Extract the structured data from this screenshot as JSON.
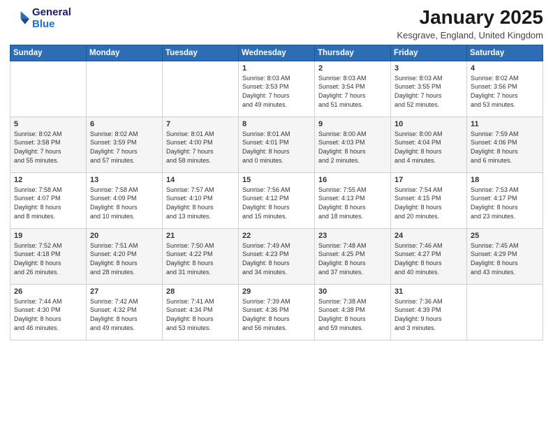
{
  "logo": {
    "line1": "General",
    "line2": "Blue"
  },
  "title": "January 2025",
  "location": "Kesgrave, England, United Kingdom",
  "days_header": [
    "Sunday",
    "Monday",
    "Tuesday",
    "Wednesday",
    "Thursday",
    "Friday",
    "Saturday"
  ],
  "weeks": [
    [
      {
        "num": "",
        "info": ""
      },
      {
        "num": "",
        "info": ""
      },
      {
        "num": "",
        "info": ""
      },
      {
        "num": "1",
        "info": "Sunrise: 8:03 AM\nSunset: 3:53 PM\nDaylight: 7 hours\nand 49 minutes."
      },
      {
        "num": "2",
        "info": "Sunrise: 8:03 AM\nSunset: 3:54 PM\nDaylight: 7 hours\nand 51 minutes."
      },
      {
        "num": "3",
        "info": "Sunrise: 8:03 AM\nSunset: 3:55 PM\nDaylight: 7 hours\nand 52 minutes."
      },
      {
        "num": "4",
        "info": "Sunrise: 8:02 AM\nSunset: 3:56 PM\nDaylight: 7 hours\nand 53 minutes."
      }
    ],
    [
      {
        "num": "5",
        "info": "Sunrise: 8:02 AM\nSunset: 3:58 PM\nDaylight: 7 hours\nand 55 minutes."
      },
      {
        "num": "6",
        "info": "Sunrise: 8:02 AM\nSunset: 3:59 PM\nDaylight: 7 hours\nand 57 minutes."
      },
      {
        "num": "7",
        "info": "Sunrise: 8:01 AM\nSunset: 4:00 PM\nDaylight: 7 hours\nand 58 minutes."
      },
      {
        "num": "8",
        "info": "Sunrise: 8:01 AM\nSunset: 4:01 PM\nDaylight: 8 hours\nand 0 minutes."
      },
      {
        "num": "9",
        "info": "Sunrise: 8:00 AM\nSunset: 4:03 PM\nDaylight: 8 hours\nand 2 minutes."
      },
      {
        "num": "10",
        "info": "Sunrise: 8:00 AM\nSunset: 4:04 PM\nDaylight: 8 hours\nand 4 minutes."
      },
      {
        "num": "11",
        "info": "Sunrise: 7:59 AM\nSunset: 4:06 PM\nDaylight: 8 hours\nand 6 minutes."
      }
    ],
    [
      {
        "num": "12",
        "info": "Sunrise: 7:58 AM\nSunset: 4:07 PM\nDaylight: 8 hours\nand 8 minutes."
      },
      {
        "num": "13",
        "info": "Sunrise: 7:58 AM\nSunset: 4:09 PM\nDaylight: 8 hours\nand 10 minutes."
      },
      {
        "num": "14",
        "info": "Sunrise: 7:57 AM\nSunset: 4:10 PM\nDaylight: 8 hours\nand 13 minutes."
      },
      {
        "num": "15",
        "info": "Sunrise: 7:56 AM\nSunset: 4:12 PM\nDaylight: 8 hours\nand 15 minutes."
      },
      {
        "num": "16",
        "info": "Sunrise: 7:55 AM\nSunset: 4:13 PM\nDaylight: 8 hours\nand 18 minutes."
      },
      {
        "num": "17",
        "info": "Sunrise: 7:54 AM\nSunset: 4:15 PM\nDaylight: 8 hours\nand 20 minutes."
      },
      {
        "num": "18",
        "info": "Sunrise: 7:53 AM\nSunset: 4:17 PM\nDaylight: 8 hours\nand 23 minutes."
      }
    ],
    [
      {
        "num": "19",
        "info": "Sunrise: 7:52 AM\nSunset: 4:18 PM\nDaylight: 8 hours\nand 26 minutes."
      },
      {
        "num": "20",
        "info": "Sunrise: 7:51 AM\nSunset: 4:20 PM\nDaylight: 8 hours\nand 28 minutes."
      },
      {
        "num": "21",
        "info": "Sunrise: 7:50 AM\nSunset: 4:22 PM\nDaylight: 8 hours\nand 31 minutes."
      },
      {
        "num": "22",
        "info": "Sunrise: 7:49 AM\nSunset: 4:23 PM\nDaylight: 8 hours\nand 34 minutes."
      },
      {
        "num": "23",
        "info": "Sunrise: 7:48 AM\nSunset: 4:25 PM\nDaylight: 8 hours\nand 37 minutes."
      },
      {
        "num": "24",
        "info": "Sunrise: 7:46 AM\nSunset: 4:27 PM\nDaylight: 8 hours\nand 40 minutes."
      },
      {
        "num": "25",
        "info": "Sunrise: 7:45 AM\nSunset: 4:29 PM\nDaylight: 8 hours\nand 43 minutes."
      }
    ],
    [
      {
        "num": "26",
        "info": "Sunrise: 7:44 AM\nSunset: 4:30 PM\nDaylight: 8 hours\nand 46 minutes."
      },
      {
        "num": "27",
        "info": "Sunrise: 7:42 AM\nSunset: 4:32 PM\nDaylight: 8 hours\nand 49 minutes."
      },
      {
        "num": "28",
        "info": "Sunrise: 7:41 AM\nSunset: 4:34 PM\nDaylight: 8 hours\nand 53 minutes."
      },
      {
        "num": "29",
        "info": "Sunrise: 7:39 AM\nSunset: 4:36 PM\nDaylight: 8 hours\nand 56 minutes."
      },
      {
        "num": "30",
        "info": "Sunrise: 7:38 AM\nSunset: 4:38 PM\nDaylight: 8 hours\nand 59 minutes."
      },
      {
        "num": "31",
        "info": "Sunrise: 7:36 AM\nSunset: 4:39 PM\nDaylight: 9 hours\nand 3 minutes."
      },
      {
        "num": "",
        "info": ""
      }
    ]
  ]
}
